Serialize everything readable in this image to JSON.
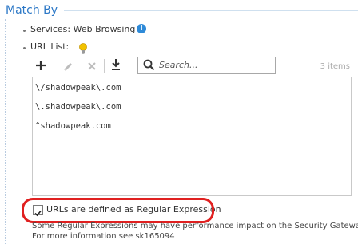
{
  "section": {
    "title": "Match By"
  },
  "services": {
    "label": "Services: Web Browsing",
    "info_icon": "info-icon"
  },
  "url_list": {
    "label": "URL List:",
    "hint_icon": "lightbulb-icon",
    "toolbar": {
      "add_icon": "plus-icon",
      "edit_icon": "pencil-icon",
      "delete_icon": "close-icon",
      "import_icon": "download-icon"
    },
    "search": {
      "placeholder": "Search..."
    },
    "count": "3 items",
    "items": [
      "\\/shadowpeak\\.com",
      "\\.shadowpeak\\.com",
      "^shadowpeak.com"
    ]
  },
  "regex_option": {
    "label": "URLs are defined as Regular Expression",
    "checked": true
  },
  "note": {
    "line1": "Some Regular Expressions may have performance impact on the Security Gateway.",
    "line2": "For more information see sk165094"
  },
  "colors": {
    "title": "#2b77c6",
    "highlight": "#e02020",
    "info": "#2e8ad8"
  }
}
